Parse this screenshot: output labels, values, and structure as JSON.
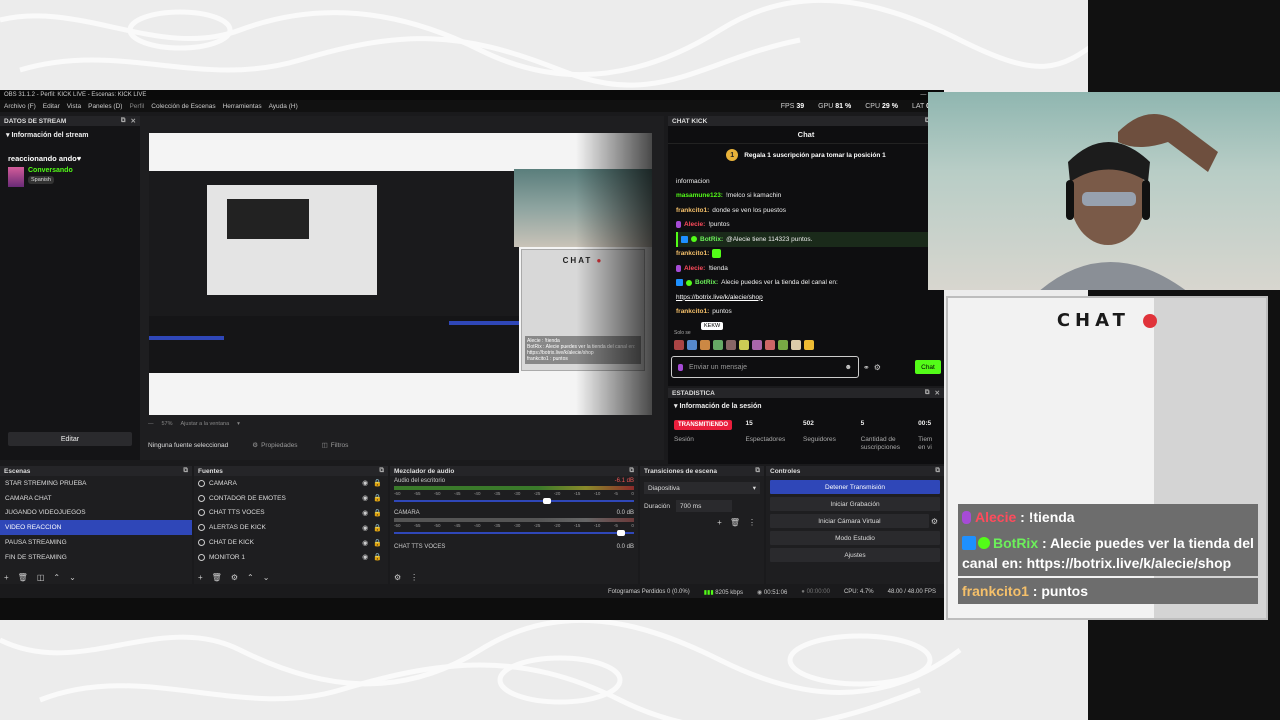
{
  "window": {
    "title": "OBS 31.1.2 - Perfil: KICK LIVE - Escenas: KICK LIVE"
  },
  "menu": [
    "Archivo (F)",
    "Editar",
    "Vista",
    "Paneles (D)",
    "Perfil",
    "Colección de Escenas",
    "Herramientas",
    "Ayuda (H)"
  ],
  "stats_bar": {
    "fps_label": "FPS",
    "fps": "39",
    "gpu_label": "GPU",
    "gpu": "81 %",
    "cpu_label": "CPU",
    "cpu": "29 %",
    "lat_label": "LAT",
    "lat": "0"
  },
  "datos": {
    "header": "DATOS DE STREAM",
    "sub": "Información del stream",
    "stream_title": "reaccionando ando♥",
    "category": "Conversando",
    "language": "Spanish",
    "edit_label": "Editar"
  },
  "preview": {
    "chat_title": "CHAT",
    "mini_msgs": [
      "Alecie : !tienda",
      "BotRix : Alecie puedes ver la tienda del canal en: https://botrix.live/k/alecie/shop",
      "frankcito1 : puntos"
    ],
    "zoom": "57%",
    "fit": "Ajustar a la ventana",
    "no_source": "Ninguna fuente seleccionad",
    "props": "Propiedades",
    "filters": "Filtros"
  },
  "chat_kick": {
    "header": "CHAT KICK",
    "tab": "Chat",
    "gift_rank": "1",
    "gift_text": "Regala 1 suscripción para tomar la posición 1",
    "lines": [
      {
        "user": "",
        "text": "informacion",
        "ucls": "u-green"
      },
      {
        "user": "masamune123:",
        "text": "!melco si kamachin",
        "ucls": "u-green"
      },
      {
        "user": "frankcito1:",
        "text": "donde se ven los puestos",
        "ucls": "u-orange"
      },
      {
        "user": "Alecie:",
        "text": "!puntos",
        "ucls": "u-red"
      },
      {
        "user": "BotRix:",
        "text": "@Alecie tiene 114323 puntos.",
        "ucls": "u-bot"
      },
      {
        "user": "frankcito1:",
        "text": "",
        "ucls": "u-orange"
      },
      {
        "user": "Alecie:",
        "text": "!tienda",
        "ucls": "u-red"
      },
      {
        "user": "BotRix:",
        "text": "Alecie puedes ver la tienda del canal en:",
        "ucls": "u-bot"
      },
      {
        "user": "",
        "text": "https://botrix.live/k/alecie/shop",
        "ucls": "u-green"
      },
      {
        "user": "frankcito1:",
        "text": "puntos",
        "ucls": "u-orange"
      }
    ],
    "solo": "Solo se",
    "tooltip": "KEKW",
    "input_placeholder": "Enviar un mensaje",
    "send_label": "Chat"
  },
  "estad": {
    "header": "ESTADISTICA",
    "sub": "Información de la sesión",
    "live": "TRANSMITIENDO",
    "session_label": "Sesión",
    "viewers": "15",
    "viewers_label": "Espectadores",
    "followers": "502",
    "followers_label": "Seguidores",
    "subs": "5",
    "subs_label": "Cantidad de suscripciones",
    "time_v": "00:5",
    "time_label": "Tiem en vi"
  },
  "scenes": {
    "header": "Escenas",
    "items": [
      "STAR STREMING PRUEBA",
      "CAMARA CHAT",
      "JUGANDO VIDEOJUEGOS",
      "VIDEO REACCION",
      "PAUSA STREAMING",
      "FIN DE STREAMING"
    ],
    "selected": 3
  },
  "sources": {
    "header": "Fuentes",
    "items": [
      "CAMARA",
      "CONTADOR DE EMOTES",
      "CHAT TTS VOCES",
      "ALERTAS DE KICK",
      "CHAT DE KICK",
      "MONITOR 1"
    ]
  },
  "mixer": {
    "header": "Mezclador de audio",
    "tracks": [
      {
        "name": "Audio del escritorio",
        "db": "-6.1 dB"
      },
      {
        "name": "CAMARA",
        "db": "0.0 dB"
      },
      {
        "name": "CHAT TTS VOCES",
        "db": "0.0 dB"
      }
    ],
    "ticks": [
      "-60",
      "-55",
      "-50",
      "-45",
      "-40",
      "-35",
      "-30",
      "-25",
      "-20",
      "-15",
      "-10",
      "-5",
      "0"
    ]
  },
  "transitions": {
    "header": "Transiciones de escena",
    "selected": "Diapositiva",
    "duration_label": "Duración",
    "duration": "700 ms"
  },
  "controls": {
    "header": "Controles",
    "buttons": [
      "Detener Transmisión",
      "Iniciar Grabación",
      "Iniciar Cámara Virtual",
      "Modo Estudio",
      "Ajustes"
    ]
  },
  "status": {
    "frames": "Fotogramas Perdidos 0 (0.0%)",
    "bitrate": "8205 kbps",
    "live_time": "00:51:06",
    "rec_time": "00:00:00",
    "cpu": "CPU: 4.7%",
    "fps": "48.00 / 48.00 FPS"
  },
  "big_chat": {
    "title": "CHAT",
    "m1_user": "Alecie",
    "m1_text": " : !tienda",
    "m2_user": "BotRix",
    "m2_text": " : Alecie puedes ver la tienda del canal en: https://botrix.live/k/alecie/shop",
    "m3_user": "frankcito1",
    "m3_text": " : puntos"
  }
}
